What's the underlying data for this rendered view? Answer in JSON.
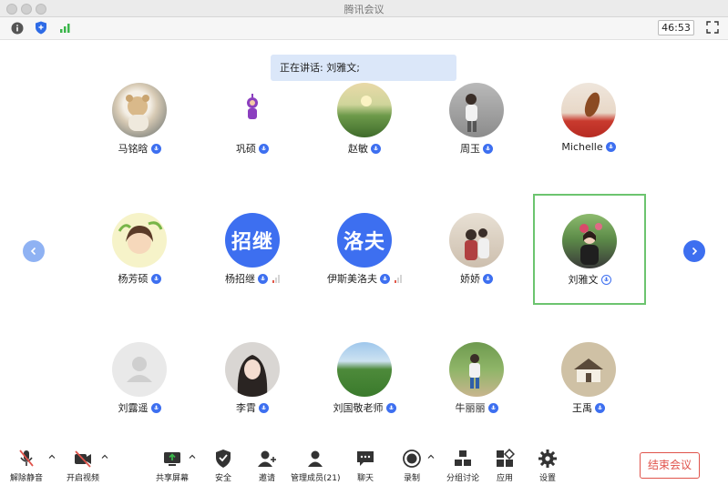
{
  "window": {
    "title": "腾讯会议"
  },
  "topbar": {
    "timer": "46:53"
  },
  "speaking": {
    "text": "正在讲话: 刘雅文;"
  },
  "participants": [
    {
      "name": "马铭晗"
    },
    {
      "name": "巩硕"
    },
    {
      "name": "赵敏"
    },
    {
      "name": "周玉"
    },
    {
      "name": "Michelle"
    },
    {
      "name": "杨芳硕"
    },
    {
      "name": "杨招继",
      "avatar_text": "招继"
    },
    {
      "name": "伊斯美洛夫",
      "avatar_text": "洛夫"
    },
    {
      "name": "娇娇"
    },
    {
      "name": "刘雅文"
    },
    {
      "name": "刘露遥"
    },
    {
      "name": "李霄"
    },
    {
      "name": "刘国敬老师"
    },
    {
      "name": "牛丽丽"
    },
    {
      "name": "王禹"
    }
  ],
  "toolbar": {
    "unmute": "解除静音",
    "start_video": "开启视频",
    "share_screen": "共享屏幕",
    "security": "安全",
    "invite": "邀请",
    "manage_members": "管理成员(21)",
    "chat": "聊天",
    "record": "录制",
    "breakout": "分组讨论",
    "apps": "应用",
    "settings": "设置",
    "end_meeting": "结束会议"
  },
  "colors": {
    "accent": "#3d6ff0",
    "active_border": "#6cc46f",
    "end_red": "#e0534b",
    "speaking_bg": "#dbe7f9"
  }
}
